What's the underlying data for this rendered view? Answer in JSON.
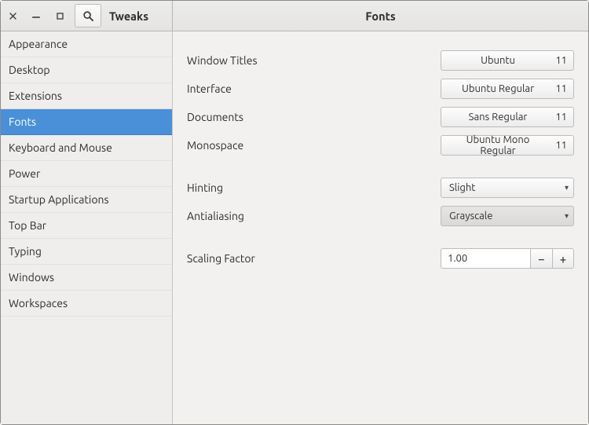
{
  "header": {
    "app_title": "Tweaks",
    "page_title": "Fonts"
  },
  "sidebar": {
    "items": [
      {
        "label": "Appearance",
        "selected": false
      },
      {
        "label": "Desktop",
        "selected": false
      },
      {
        "label": "Extensions",
        "selected": false
      },
      {
        "label": "Fonts",
        "selected": true
      },
      {
        "label": "Keyboard and Mouse",
        "selected": false
      },
      {
        "label": "Power",
        "selected": false
      },
      {
        "label": "Startup Applications",
        "selected": false
      },
      {
        "label": "Top Bar",
        "selected": false
      },
      {
        "label": "Typing",
        "selected": false
      },
      {
        "label": "Windows",
        "selected": false
      },
      {
        "label": "Workspaces",
        "selected": false
      }
    ]
  },
  "labels": {
    "window_titles": "Window Titles",
    "interface": "Interface",
    "documents": "Documents",
    "monospace": "Monospace",
    "hinting": "Hinting",
    "antialiasing": "Antialiasing",
    "scaling_factor": "Scaling Factor"
  },
  "fonts": {
    "window_titles": {
      "name": "Ubuntu",
      "size": "11"
    },
    "interface": {
      "name": "Ubuntu Regular",
      "size": "11"
    },
    "documents": {
      "name": "Sans Regular",
      "size": "11"
    },
    "monospace": {
      "name": "Ubuntu Mono Regular",
      "size": "11"
    }
  },
  "hinting": {
    "value": "Slight"
  },
  "antialiasing": {
    "value": "Grayscale"
  },
  "scaling_factor": {
    "value": "1.00"
  }
}
